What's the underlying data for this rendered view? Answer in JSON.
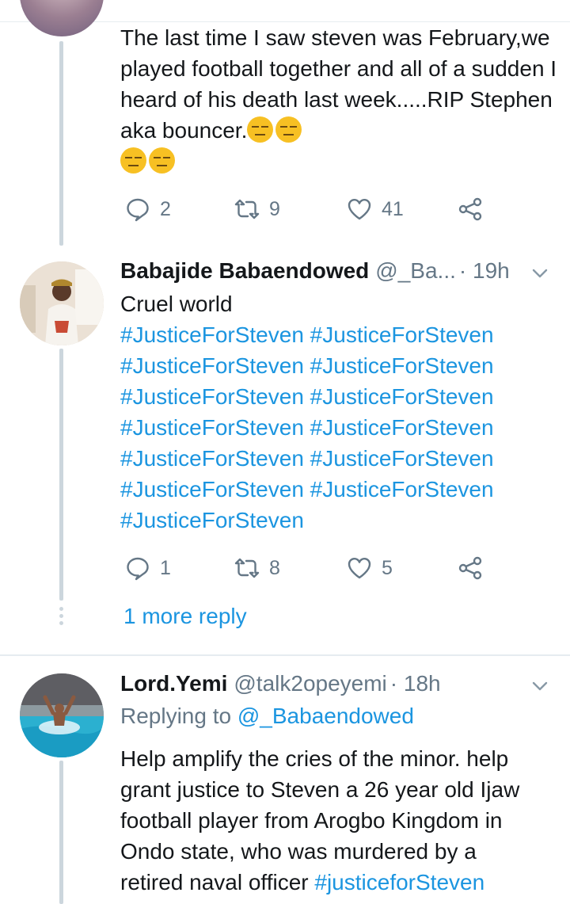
{
  "tweet1": {
    "text": "The last time I saw steven was February,we played football together and all of a sudden I heard of his death last week.....RIP Stephen aka bouncer.",
    "emoji_icons": [
      "expressionless-face-icon",
      "expressionless-face-icon",
      "expressionless-face-icon",
      "expressionless-face-icon"
    ],
    "reply_count": "2",
    "retweet_count": "9",
    "like_count": "41"
  },
  "tweet2": {
    "name": "Babajide Babaendowed",
    "handle": "@_Ba...",
    "time": "· 19h",
    "text": "Cruel world",
    "hashtags": [
      "#JusticeForSteven",
      "#JusticeForSteven",
      "#JusticeForSteven",
      "#JusticeForSteven",
      "#JusticeForSteven",
      "#JusticeForSteven",
      "#JusticeForSteven",
      "#JusticeForSteven",
      "#JusticeForSteven",
      "#JusticeForSteven",
      "#JusticeForSteven",
      "#JusticeForSteven",
      "#JusticeForSteven"
    ],
    "reply_count": "1",
    "retweet_count": "8",
    "like_count": "5",
    "more_replies": "1 more reply"
  },
  "tweet3": {
    "name": "Lord.Yemi",
    "handle": "@talk2opeyemi",
    "time": "· 18h",
    "replying_prefix": "Replying to",
    "replying_to": "@_Babaendowed",
    "text_lines": [
      "Help amplify the cries of the minor. help",
      "grant justice to Steven a 26 year old Ijaw",
      "football player from Arogbo Kingdom in",
      "Ondo state, who was murdered by a"
    ],
    "partial_text": "retired naval officer",
    "partial_hashtag": "#justiceforSteven"
  },
  "colors": {
    "link": "#1b95e0",
    "secondary_text": "#657786",
    "primary_text": "#14171a",
    "divider": "#e6ecf0",
    "thread_line": "#ccd6dd"
  }
}
